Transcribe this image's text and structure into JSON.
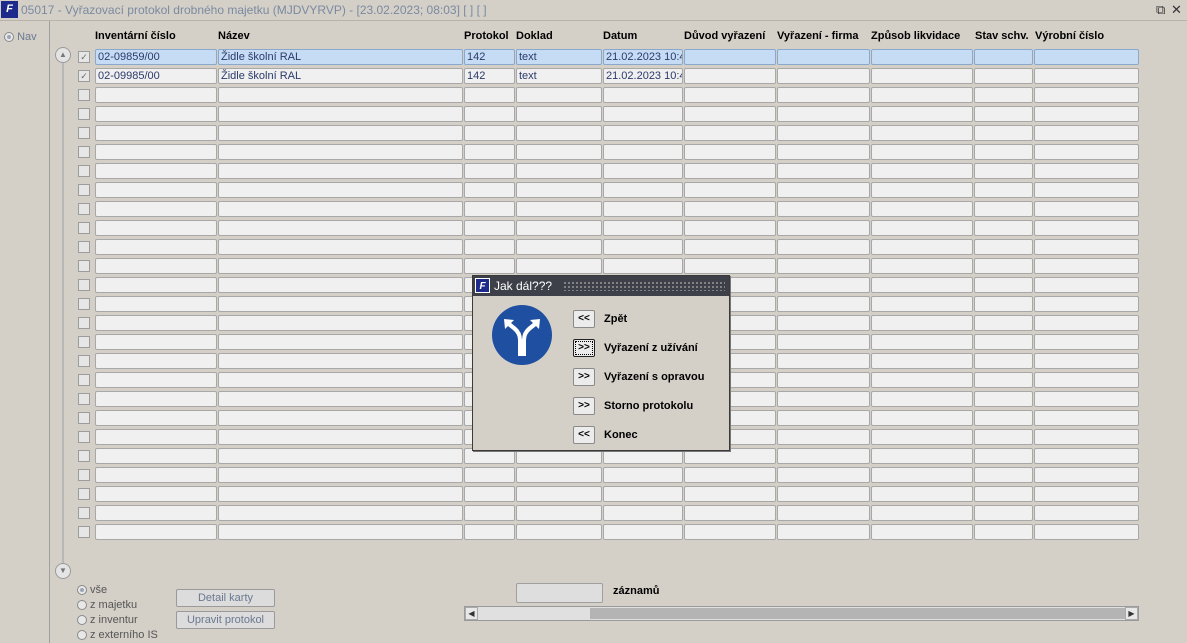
{
  "window": {
    "title": "05017 - Vyřazovací protokol drobného majetku (MJDVYRVP) - [23.02.2023; 08:03]  [ ]  [ ]",
    "logo": "F"
  },
  "left": {
    "nav_label": "Nav"
  },
  "columns": [
    "Inventární číslo",
    "Název",
    "Protokol",
    "Doklad",
    "Datum",
    "Důvod vyřazení",
    "Vyřazení - firma",
    "Způsob likvidace",
    "Stav schv.",
    "Výrobní číslo"
  ],
  "rows": [
    {
      "checked": true,
      "cells": [
        "02-09859/00",
        "Židle školní RAL",
        "142",
        "text",
        "21.02.2023 10:4",
        "",
        "",
        "",
        "",
        ""
      ]
    },
    {
      "checked": true,
      "cells": [
        "02-09985/00",
        "Židle školní RAL",
        "142",
        "text",
        "21.02.2023 10:4",
        "",
        "",
        "",
        "",
        ""
      ]
    }
  ],
  "empty_row_count": 24,
  "filters": [
    {
      "label": "vše",
      "selected": true
    },
    {
      "label": "z majetku",
      "selected": false
    },
    {
      "label": "z inventur",
      "selected": false
    },
    {
      "label": "z externího IS",
      "selected": false
    }
  ],
  "buttons": {
    "detail": "Detail karty",
    "edit": "Upravit protokol"
  },
  "count_label": "záznamů",
  "dialog": {
    "title": "Jak dál???",
    "icon": "direction-sign-icon",
    "options": [
      {
        "btn": "<<",
        "label": "Zpět",
        "focused": false
      },
      {
        "btn": ">>",
        "label": "Vyřazení z užívání",
        "focused": true
      },
      {
        "btn": ">>",
        "label": "Vyřazení s opravou",
        "focused": false
      },
      {
        "btn": ">>",
        "label": "Storno protokolu",
        "focused": false
      },
      {
        "btn": "<<",
        "label": "Konec",
        "focused": false
      }
    ]
  }
}
